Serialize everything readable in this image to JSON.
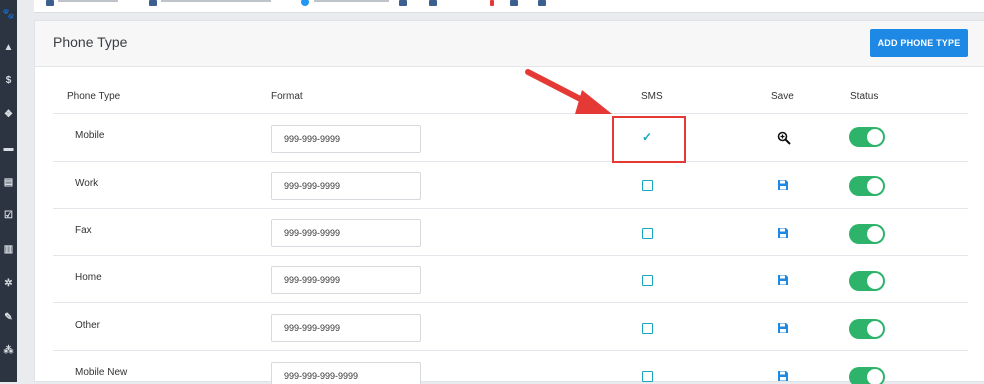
{
  "sidebar": {
    "icons": [
      "paw-icon",
      "flask-icon",
      "dollar-icon",
      "cubes-icon",
      "chat-icon",
      "list-icon",
      "check-square-icon",
      "chart-icon",
      "gear-icon",
      "wrench-icon",
      "share-icon"
    ],
    "glyphs": [
      "🐾",
      "▲",
      "$",
      "❖",
      "▬",
      "▤",
      "☑",
      "▥",
      "✲",
      "✎",
      "⁂"
    ]
  },
  "panel": {
    "title": "Phone Type",
    "add_button_label": "ADD PHONE TYPE"
  },
  "table": {
    "headers": {
      "phone_type": "Phone Type",
      "format": "Format",
      "sms": "SMS",
      "save": "Save",
      "status": "Status"
    },
    "rows": [
      {
        "label": "Mobile",
        "format": "999-999-9999",
        "sms": true,
        "save_icon": "zoom-in-cursor-icon",
        "status": "on"
      },
      {
        "label": "Work",
        "format": "999-999-9999",
        "sms": false,
        "save_icon": "floppy-disk-icon",
        "status": "on"
      },
      {
        "label": "Fax",
        "format": "999-999-9999",
        "sms": false,
        "save_icon": "floppy-disk-icon",
        "status": "on"
      },
      {
        "label": "Home",
        "format": "999-999-9999",
        "sms": false,
        "save_icon": "floppy-disk-icon",
        "status": "on"
      },
      {
        "label": "Other",
        "format": "999-999-9999",
        "sms": false,
        "save_icon": "floppy-disk-icon",
        "status": "on"
      },
      {
        "label": "Mobile New",
        "format": "999-999-999-9999",
        "sms": false,
        "save_icon": "floppy-disk-icon",
        "status": "on"
      }
    ]
  },
  "colors": {
    "accent": "#1e88e5",
    "toggle_on": "#2db36a",
    "sms_teal": "#1ba7c0",
    "annotation_red": "#e53935"
  }
}
